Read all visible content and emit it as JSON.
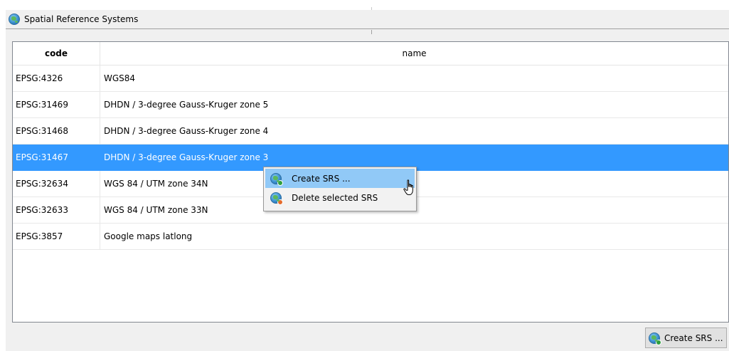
{
  "panel": {
    "title": "Spatial Reference Systems",
    "icon": "globe-icon"
  },
  "table": {
    "columns": {
      "code": "code",
      "name": "name"
    },
    "rows": [
      {
        "code": "EPSG:4326",
        "name": "WGS84",
        "selected": false
      },
      {
        "code": "EPSG:31469",
        "name": "DHDN / 3-degree Gauss-Kruger zone 5",
        "selected": false
      },
      {
        "code": "EPSG:31468",
        "name": "DHDN / 3-degree Gauss-Kruger zone 4",
        "selected": false
      },
      {
        "code": "EPSG:31467",
        "name": "DHDN / 3-degree Gauss-Kruger zone 3",
        "selected": true
      },
      {
        "code": "EPSG:32634",
        "name": "WGS 84 / UTM zone 34N",
        "selected": false
      },
      {
        "code": "EPSG:32633",
        "name": "WGS 84 / UTM zone 33N",
        "selected": false
      },
      {
        "code": "EPSG:3857",
        "name": "Google maps latlong",
        "selected": false
      }
    ]
  },
  "context_menu": {
    "items": [
      {
        "label": "Create SRS ...",
        "icon": "globe-add-icon",
        "highlighted": true
      },
      {
        "label": "Delete selected SRS",
        "icon": "globe-delete-icon",
        "highlighted": false
      }
    ]
  },
  "footer": {
    "create_button_label": "Create SRS ...",
    "create_button_icon": "globe-add-icon"
  },
  "colors": {
    "selection": "#3399ff",
    "menu_highlight": "#91c9f7",
    "panel_background": "#f0f0f0"
  }
}
